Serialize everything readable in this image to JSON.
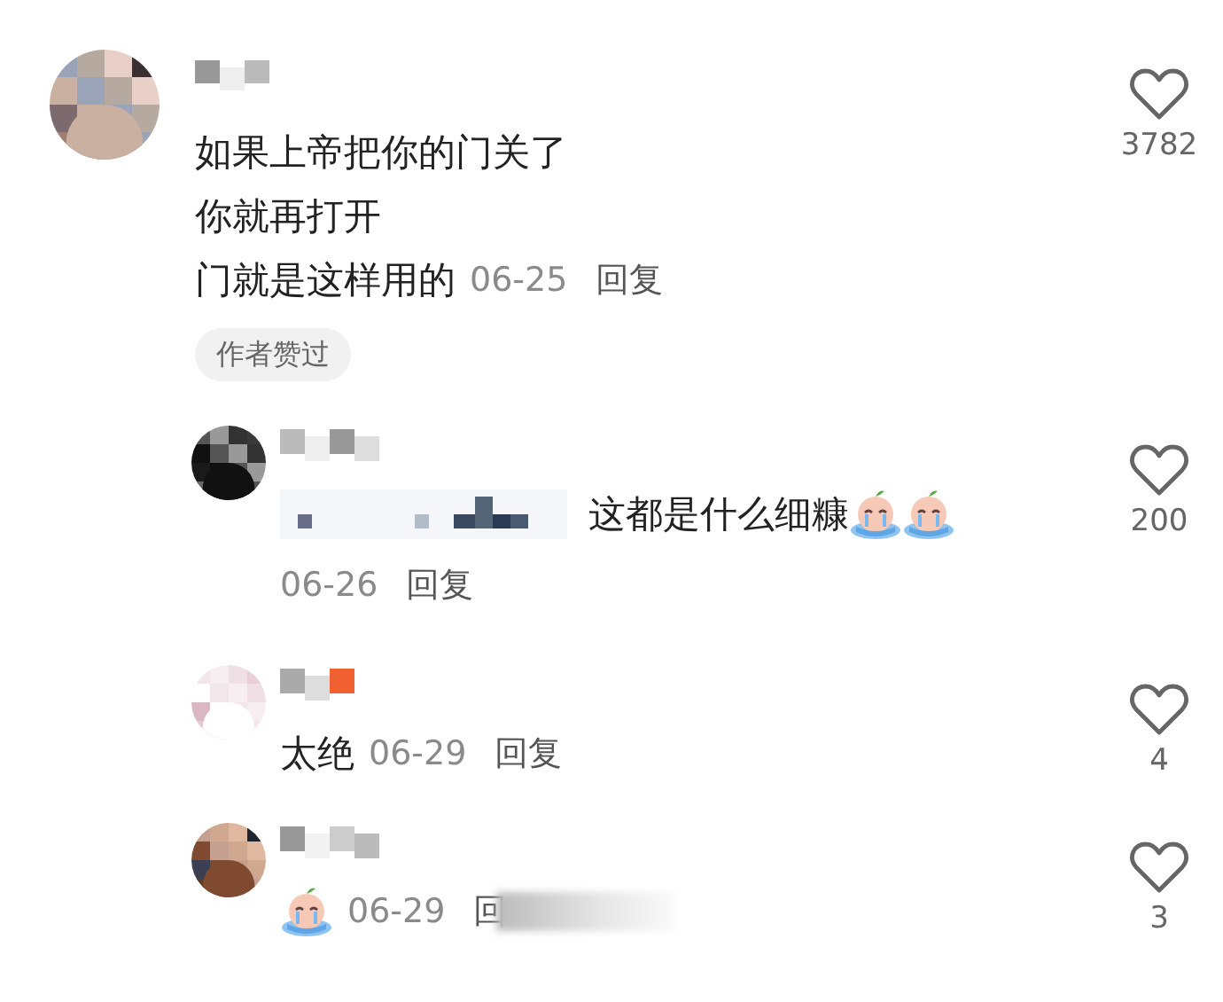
{
  "comments": [
    {
      "kind": "top",
      "lines": [
        "如果上帝把你的门关了",
        "你就再打开",
        "门就是这样用的"
      ],
      "date": "06-25",
      "reply": "回复",
      "badge": "作者赞过",
      "likes": "3782",
      "liked": false
    },
    {
      "kind": "reply",
      "parts": [
        {
          "kind": "redacted"
        },
        {
          "kind": "text",
          "text": "这都是什么细糠"
        },
        {
          "kind": "emoji"
        },
        {
          "kind": "emoji"
        }
      ],
      "date": "06-26",
      "reply": "回复",
      "date_on_own_line": true,
      "likes": "200",
      "liked": false
    },
    {
      "kind": "reply",
      "parts": [
        {
          "kind": "text",
          "text": "太绝"
        }
      ],
      "date": "06-29",
      "reply": "回复",
      "date_on_own_line": false,
      "likes": "4",
      "liked": false
    },
    {
      "kind": "reply",
      "parts": [
        {
          "kind": "emoji"
        }
      ],
      "date": "06-29",
      "reply": "回",
      "reply_covered": true,
      "date_on_own_line": false,
      "likes": "3",
      "liked": false
    }
  ]
}
